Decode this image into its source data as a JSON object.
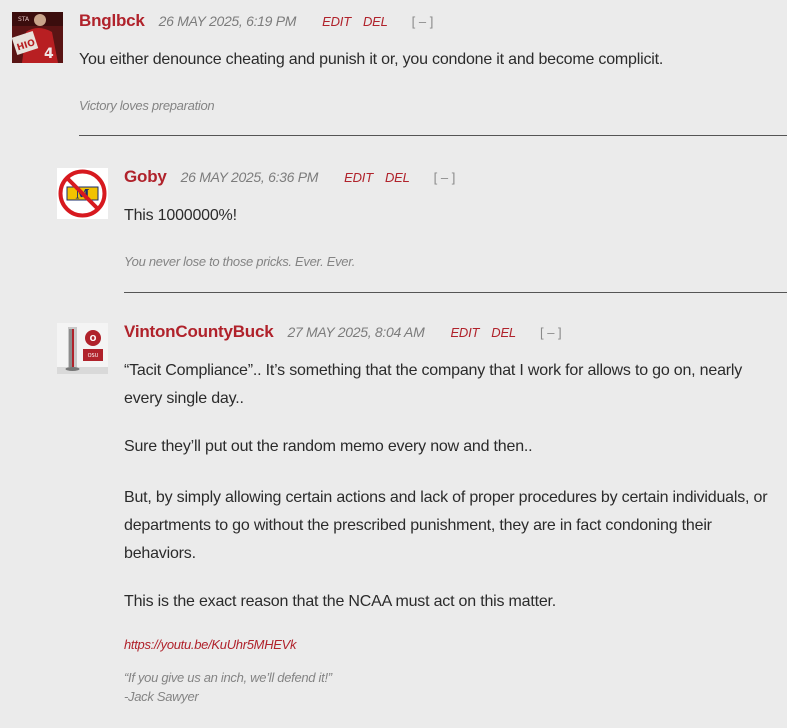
{
  "comments": [
    {
      "author": "Bnglbck",
      "date": "26 MAY 2025, 6:19 PM",
      "edit_label": "EDIT",
      "del_label": "DEL",
      "collapse_label": "[ – ]",
      "paragraphs": [
        "You either denounce cheating and punish it or, you condone it and become complicit."
      ],
      "signature": "Victory loves preparation",
      "avatar_icon": "football-player-photo-icon"
    },
    {
      "author": "Goby",
      "date": "26 MAY 2025, 6:36 PM",
      "edit_label": "EDIT",
      "del_label": "DEL",
      "collapse_label": "[ – ]",
      "paragraphs": [
        "This 1000000%!"
      ],
      "signature": "You never lose to those pricks. Ever. Ever.",
      "avatar_icon": "no-michigan-icon"
    },
    {
      "author": "VintonCountyBuck",
      "date": "27 MAY 2025, 8:04 AM",
      "edit_label": "EDIT",
      "del_label": "DEL",
      "collapse_label": "[ – ]",
      "paragraphs": [
        "“Tacit Compliance”.. It’s something that the company that I work for allows to go on, nearly every single day..",
        "Sure they’ll put out the random memo every now and then..",
        "But, by simply allowing certain actions and lack of proper procedures by certain individuals, or departments to go without the prescribed punishment, they are in fact condoning their behaviors.",
        "This is the exact reason that the NCAA must act on this matter."
      ],
      "link": "https://youtu.be/KuUhr5MHEVk",
      "signature_lines": [
        "“If you give us an inch, we’ll defend it!”",
        "-Jack Sawyer"
      ],
      "avatar_icon": "ohio-state-pole-icon"
    }
  ],
  "colors": {
    "accent": "#b0222b",
    "background": "#ebebeb",
    "text": "#2b2b2b",
    "muted": "#7c7c7c"
  }
}
